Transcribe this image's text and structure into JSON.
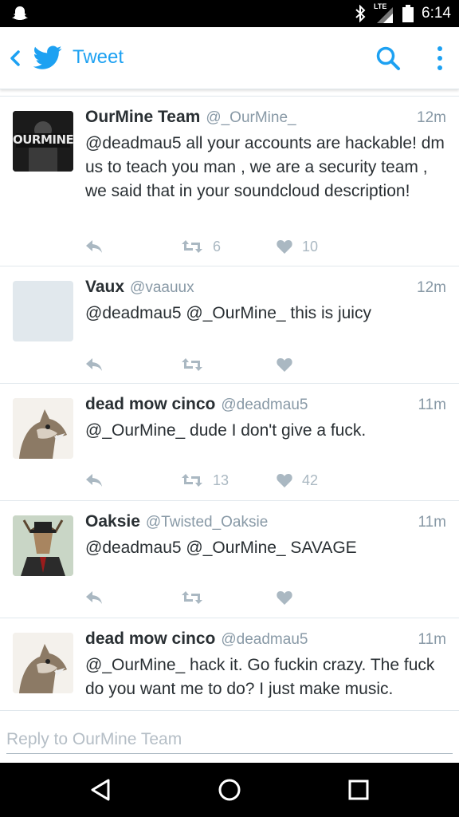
{
  "status_bar": {
    "time": "6:14",
    "network_label": "LTE",
    "icons": [
      "snapchat-ghost-icon",
      "bluetooth-icon",
      "signal-icon",
      "battery-icon"
    ]
  },
  "app_bar": {
    "title": "Tweet",
    "icons": [
      "back-icon",
      "twitter-bird-icon",
      "search-icon",
      "more-vertical-icon"
    ]
  },
  "colors": {
    "accent": "#1da1f2",
    "muted": "#8899a6",
    "action": "#aab8c2",
    "divider": "#e1e8ed"
  },
  "tweets": [
    {
      "name": "OurMine Team",
      "handle": "@_OurMine_",
      "time": "12m",
      "avatar_text": "OURMINE",
      "text": "@deadmau5 all your accounts are hackable! dm us to teach you man , we are a security team , we said that in your soundcloud description!",
      "retweets": "6",
      "likes": "10"
    },
    {
      "name": "Vaux",
      "handle": "@vaauux",
      "time": "12m",
      "text": "@deadmau5 @_OurMine_ this is juicy",
      "retweets": "",
      "likes": ""
    },
    {
      "name": "dead mow cinco",
      "handle": "@deadmau5",
      "time": "11m",
      "text": "@_OurMine_ dude I don't give a fuck.",
      "retweets": "13",
      "likes": "42"
    },
    {
      "name": "Oaksie",
      "handle": "@Twisted_Oaksie",
      "time": "11m",
      "text": "@deadmau5 @_OurMine_ SAVAGE",
      "retweets": "",
      "likes": ""
    },
    {
      "name": "dead mow cinco",
      "handle": "@deadmau5",
      "time": "11m",
      "text": "@_OurMine_ hack it. Go fuckin crazy. The fuck do you want me to do? I just make music.",
      "retweets": "",
      "likes": ""
    }
  ],
  "reply": {
    "placeholder": "Reply to OurMine Team"
  },
  "nav_bar": {
    "icons": [
      "nav-back-icon",
      "nav-home-icon",
      "nav-recents-icon"
    ]
  }
}
